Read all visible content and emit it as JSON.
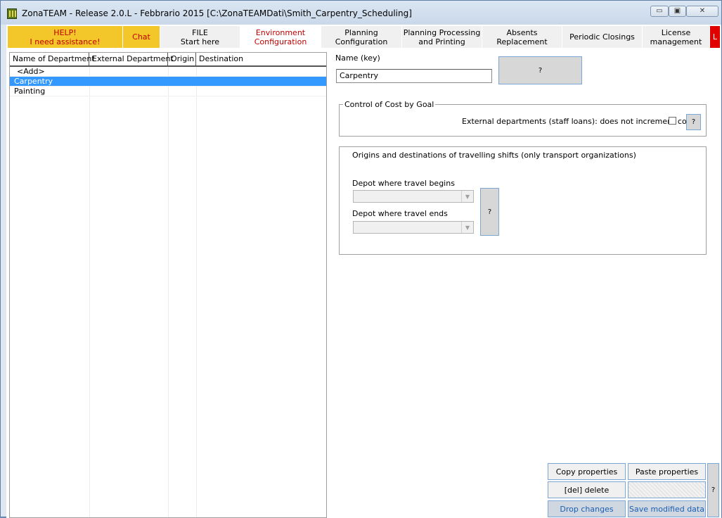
{
  "window": {
    "title": "ZonaTEAM - Release 2.0.L - Febbrario 2015 [C:\\ZonaTEAMDati\\Smith_Carpentry_Scheduling]",
    "minimize_label": "▭",
    "maximize_label": "▣",
    "close_label": "✕"
  },
  "tabs": [
    {
      "label": "HELP!\nI need assistance!",
      "style": "yellow"
    },
    {
      "label": "Chat",
      "style": "yellow"
    },
    {
      "label": "FILE\nStart here",
      "style": "normal"
    },
    {
      "label": "Environment\nConfiguration",
      "style": "active"
    },
    {
      "label": "Planning Configuration",
      "style": "normal"
    },
    {
      "label": "Planning Processing\nand Printing",
      "style": "normal"
    },
    {
      "label": "Absents Replacement",
      "style": "normal"
    },
    {
      "label": "Periodic Closings",
      "style": "normal"
    },
    {
      "label": "License\nmanagement",
      "style": "normal"
    },
    {
      "label": "L",
      "style": "red"
    }
  ],
  "department_list": {
    "columns": [
      "Name of Department",
      "External Department",
      "Origin",
      "Destination"
    ],
    "rows": [
      {
        "name": "<Add>",
        "external": "",
        "origin": "",
        "destination": "",
        "selected": false
      },
      {
        "name": "Carpentry",
        "external": "",
        "origin": "",
        "destination": "",
        "selected": true
      },
      {
        "name": "Painting",
        "external": "",
        "origin": "",
        "destination": "",
        "selected": false
      }
    ]
  },
  "form": {
    "name_label": "Name (key)",
    "name_value": "Carpentry",
    "name_help": "?",
    "cost_group_title": "Control of Cost by Goal",
    "external_label": "External departments (staff loans): does not increment cost",
    "external_checked": false,
    "external_help": "?",
    "travel_group_title": "Origins and destinations of travelling shifts (only transport organizations)",
    "depot_begins_label": "Depot where travel begins",
    "depot_begins_value": "",
    "depot_ends_label": "Depot where travel ends",
    "depot_ends_value": "",
    "depot_help": "?"
  },
  "actions": {
    "copy": "Copy properties",
    "paste": "Paste properties",
    "delete": "[del] delete",
    "drop": "Drop changes",
    "save": "Save modified data",
    "help": "?"
  },
  "colors": {
    "selection": "#3399ff",
    "help_tab": "#f3c62a",
    "active_tab_text": "#c00000"
  }
}
